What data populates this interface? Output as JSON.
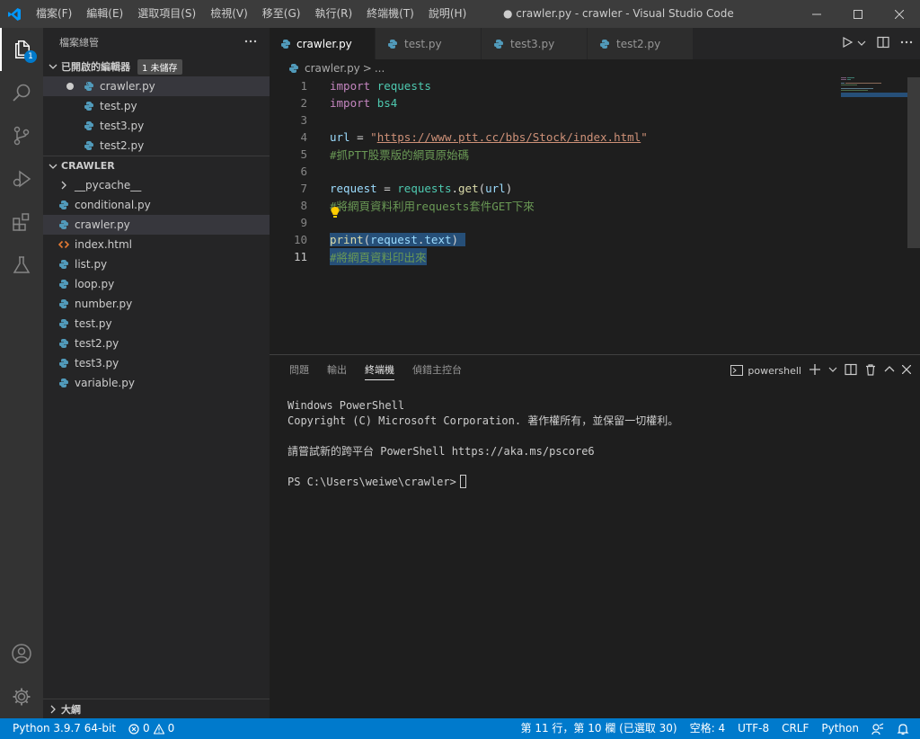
{
  "menu": [
    "檔案(F)",
    "編輯(E)",
    "選取項目(S)",
    "檢視(V)",
    "移至(G)",
    "執行(R)",
    "終端機(T)",
    "說明(H)"
  ],
  "window_title": "● crawler.py - crawler - Visual Studio Code",
  "activity": {
    "explorer_badge": "1"
  },
  "sidebar": {
    "title": "檔案總管",
    "open_editors": {
      "label": "已開啟的編輯器",
      "badge": "1 未儲存",
      "files": [
        "crawler.py",
        "test.py",
        "test3.py",
        "test2.py"
      ]
    },
    "folder": {
      "label": "CRAWLER",
      "pycache": "__pycache__",
      "files": [
        "conditional.py",
        "crawler.py",
        "index.html",
        "list.py",
        "loop.py",
        "number.py",
        "test.py",
        "test2.py",
        "test3.py",
        "variable.py"
      ]
    },
    "outline": "大綱"
  },
  "tabs": [
    "crawler.py",
    "test.py",
    "test3.py",
    "test2.py"
  ],
  "breadcrumb": {
    "file": "crawler.py",
    "sep": ">",
    "rest": "..."
  },
  "editor": {
    "line_numbers": [
      "1",
      "2",
      "3",
      "4",
      "5",
      "6",
      "7",
      "8",
      "9",
      "10",
      "11"
    ],
    "lines": {
      "l1_kw": "import",
      "l1_mod": "requests",
      "l2_kw": "import",
      "l2_mod": "bs4",
      "l4_var": "url",
      "l4_eq": " = ",
      "l4_q1": "\"",
      "l4_str": "https://www.ptt.cc/bbs/Stock/index.html",
      "l4_q2": "\"",
      "l5_cmt": "#抓PTT股票版的網頁原始碼",
      "l7_var": "request",
      "l7_eq": " = ",
      "l7_mod": "requests",
      "l7_dot": ".",
      "l7_fn": "get",
      "l7_open": "(",
      "l7_arg": "url",
      "l7_close": ")",
      "l8_cmt": "#將網頁資料利用requests套件GET下來",
      "l10_fn": "print",
      "l10_open": "(",
      "l10_var": "request",
      "l10_dot": ".",
      "l10_attr": "text",
      "l10_close": ")",
      "l11_cmt": "#將網頁資料印出來"
    }
  },
  "panel": {
    "tabs": [
      "問題",
      "輸出",
      "終端機",
      "偵錯主控台"
    ],
    "shell": "powershell",
    "terminal_lines": [
      "Windows PowerShell",
      "Copyright (C) Microsoft Corporation. 著作權所有，並保留一切權利。",
      "",
      "請嘗試新的跨平台 PowerShell https://aka.ms/pscore6",
      ""
    ],
    "prompt": "PS C:\\Users\\weiwe\\crawler>"
  },
  "status": {
    "python": "Python 3.9.7 64-bit",
    "errors": "0",
    "warnings": "0",
    "position": "第 11 行，第 10 欄 (已選取 30)",
    "spaces": "空格: 4",
    "encoding": "UTF-8",
    "eol": "CRLF",
    "language": "Python"
  },
  "colors": {
    "accent": "#007acc",
    "selection": "#264f78",
    "python_icon": "#519aba",
    "html_icon": "#e37933"
  }
}
